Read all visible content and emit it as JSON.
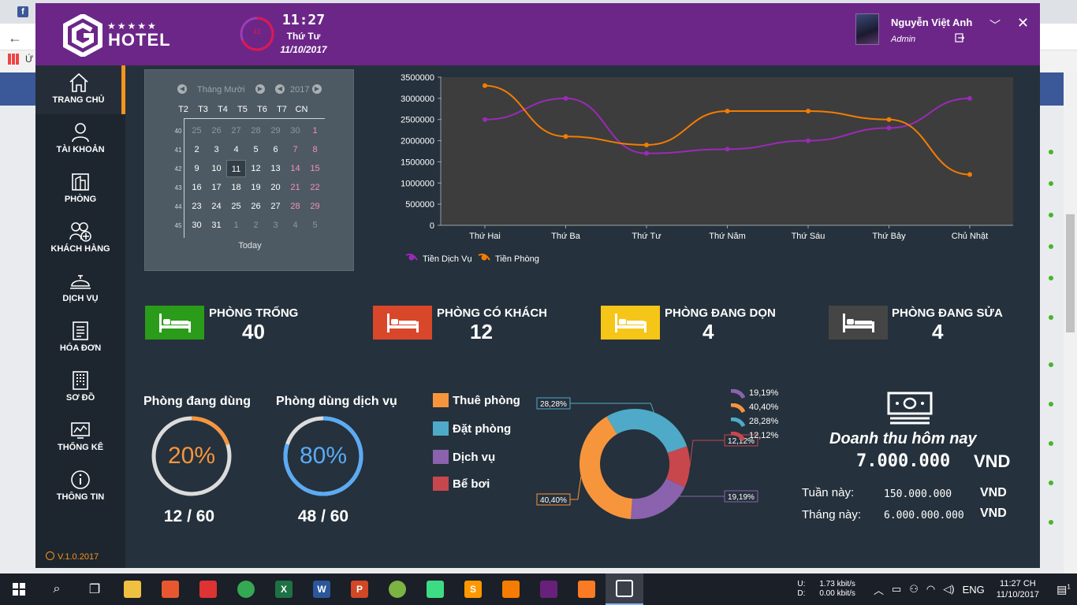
{
  "browser": {
    "bookmark_text": "Ứ"
  },
  "header": {
    "logo_text": "HOTEL",
    "logo_stars": "★★★★★",
    "clock": {
      "seconds": "41",
      "time": "11:27",
      "day": "Thứ Tư",
      "date": "11/10/2017"
    },
    "user": {
      "name": "Nguyễn Việt Anh",
      "role": "Admin"
    }
  },
  "sidebar": {
    "items": [
      {
        "label": "TRANG CHỦ",
        "icon": "home-icon"
      },
      {
        "label": "TÀI KHOẢN",
        "icon": "user-icon"
      },
      {
        "label": "PHÒNG",
        "icon": "room-icon"
      },
      {
        "label": "KHÁCH HÀNG",
        "icon": "add-customer-icon"
      },
      {
        "label": "DỊCH VỤ",
        "icon": "service-bell-icon"
      },
      {
        "label": "HÓA ĐƠN",
        "icon": "invoice-icon"
      },
      {
        "label": "SƠ ĐỒ",
        "icon": "building-map-icon"
      },
      {
        "label": "THỐNG KÊ",
        "icon": "statistics-icon"
      },
      {
        "label": "THÔNG TIN",
        "icon": "info-icon"
      }
    ],
    "version": "V.1.0.2017"
  },
  "calendar": {
    "month": "Tháng Mười",
    "year": "2017",
    "day_headers": [
      "T2",
      "T3",
      "T4",
      "T5",
      "T6",
      "T7",
      "CN"
    ],
    "weeks": [
      {
        "num": "40",
        "days": [
          "25",
          "26",
          "27",
          "28",
          "29",
          "30",
          "1"
        ]
      },
      {
        "num": "41",
        "days": [
          "2",
          "3",
          "4",
          "5",
          "6",
          "7",
          "8"
        ]
      },
      {
        "num": "42",
        "days": [
          "9",
          "10",
          "11",
          "12",
          "13",
          "14",
          "15"
        ]
      },
      {
        "num": "43",
        "days": [
          "16",
          "17",
          "18",
          "19",
          "20",
          "21",
          "22"
        ]
      },
      {
        "num": "44",
        "days": [
          "23",
          "24",
          "25",
          "26",
          "27",
          "28",
          "29"
        ]
      },
      {
        "num": "45",
        "days": [
          "30",
          "31",
          "1",
          "2",
          "3",
          "4",
          "5"
        ]
      }
    ],
    "selected_day": "11",
    "today_label": "Today"
  },
  "rooms": [
    {
      "title": "PHÒNG TRỐNG",
      "count": "40",
      "color": "#2b9b1a"
    },
    {
      "title": "PHÒNG CÓ KHÁCH",
      "count": "12",
      "color": "#d9472b"
    },
    {
      "title": "PHÒNG ĐANG DỌN",
      "count": "4",
      "color": "#f5c518"
    },
    {
      "title": "PHÒNG ĐANG SỬA",
      "count": "4",
      "color": "#454545"
    }
  ],
  "gauges": [
    {
      "title": "Phòng đang dùng",
      "percent_label": "20%",
      "fraction": 0.2,
      "ratio": "12 / 60",
      "color": "#f7953d"
    },
    {
      "title": "Phòng dùng dịch vụ",
      "percent_label": "80%",
      "fraction": 0.8,
      "ratio": "48 / 60",
      "color": "#5aabf5"
    }
  ],
  "services": {
    "legend": [
      {
        "label": "Thuê phòng",
        "color": "#f7953d"
      },
      {
        "label": "Đặt phòng",
        "color": "#4eaac8"
      },
      {
        "label": "Dịch vụ",
        "color": "#8a62ad"
      },
      {
        "label": "Bể bơi",
        "color": "#c8474d"
      }
    ],
    "mini_legend": [
      "19,19%",
      "40,40%",
      "28,28%",
      "12,12%"
    ]
  },
  "revenue": {
    "title": "Doanh thu hôm nay",
    "today_amount": "7.000.000",
    "currency": "VND",
    "week_label": "Tuần này:",
    "week_amount": "150.000.000",
    "month_label": "Tháng này:",
    "month_amount": "6.000.000.000"
  },
  "taskbar": {
    "net_up": "1.73 kbit/s",
    "net_down": "0.00 kbit/s",
    "ud_labels": "U:\nD:",
    "lang": "ENG",
    "time": "11:27 CH",
    "date": "11/10/2017",
    "notif_count": "1"
  },
  "chart_data": [
    {
      "type": "line",
      "categories": [
        "Thứ Hai",
        "Thứ Ba",
        "Thứ Tư",
        "Thứ Năm",
        "Thứ Sáu",
        "Thứ Bảy",
        "Chủ Nhật"
      ],
      "series": [
        {
          "name": "Tiền Dịch Vụ",
          "color": "#9b2ab8",
          "values": [
            2500000,
            3000000,
            1700000,
            1800000,
            2000000,
            2300000,
            3000000
          ]
        },
        {
          "name": "Tiền Phòng",
          "color": "#f57c00",
          "values": [
            3300000,
            2100000,
            1900000,
            2700000,
            2700000,
            2500000,
            1200000
          ]
        }
      ],
      "yticks": [
        "0",
        "500000",
        "1000000",
        "1500000",
        "2000000",
        "2500000",
        "3000000",
        "3500000"
      ],
      "ylim": [
        0,
        3500000
      ],
      "legend_position": "bottom-left",
      "grid": true
    },
    {
      "type": "pie",
      "donut": true,
      "slices": [
        {
          "legend": "Thuê phòng",
          "value": 40.4,
          "label": "40,40%",
          "color": "#f7953d"
        },
        {
          "legend": "Đặt phòng",
          "value": 28.28,
          "label": "28,28%",
          "color": "#4eaac8"
        },
        {
          "legend": "Dịch vụ",
          "value": 19.19,
          "label": "19,19%",
          "color": "#8a62ad"
        },
        {
          "legend": "Bể bơi",
          "value": 12.12,
          "label": "12,12%",
          "color": "#c8474d"
        }
      ]
    }
  ]
}
